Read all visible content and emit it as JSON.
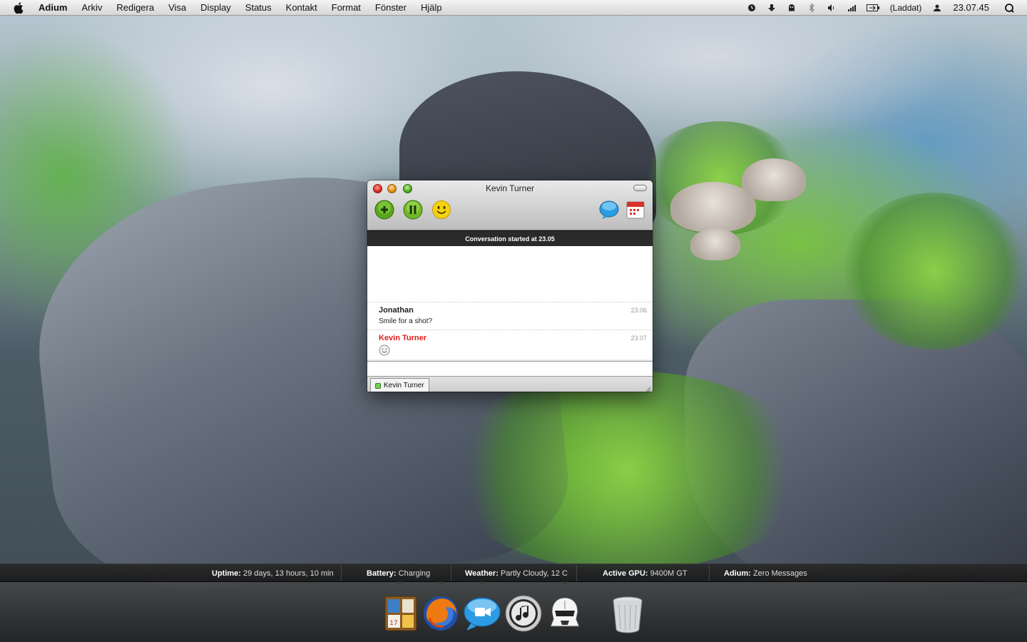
{
  "menubar": {
    "app_name": "Adium",
    "menus": [
      "Arkiv",
      "Redigera",
      "Visa",
      "Display",
      "Status",
      "Kontakt",
      "Format",
      "Fönster",
      "Hjälp"
    ],
    "battery_text": "(Laddat)",
    "clock": "23.07.45",
    "icons": [
      "apple-icon",
      "timemachine-icon",
      "download-icon",
      "adium-icon",
      "bluetooth-icon",
      "volume-icon",
      "signal-icon",
      "battery-icon",
      "user-icon",
      "spotlight-icon"
    ]
  },
  "chat": {
    "title": "Kevin Turner",
    "banner": "Conversation started at 23.05",
    "messages": [
      {
        "sender": "Jonathan",
        "time": "23.06",
        "text": "Smile for a shot?",
        "color": "#222222"
      },
      {
        "sender": "Kevin Turner",
        "time": "23.07",
        "text": "",
        "color": "#e0201a"
      }
    ],
    "tab_label": "Kevin Turner"
  },
  "info_strip": {
    "uptime_label": "Uptime:",
    "uptime_value": "29 days, 13 hours, 10 min",
    "battery_label": "Battery:",
    "battery_value": "Charging",
    "weather_label": "Weather:",
    "weather_value": "Partly Cloudy, 12 C",
    "gpu_label": "Active GPU:",
    "gpu_value": "9400M GT",
    "adium_label": "Adium:",
    "adium_value": "Zero Messages"
  },
  "dock": {
    "items": [
      "dashboard-icon",
      "firefox-icon",
      "ichat-icon",
      "itunes-icon",
      "stormtrooper-icon",
      "trash-icon"
    ]
  }
}
